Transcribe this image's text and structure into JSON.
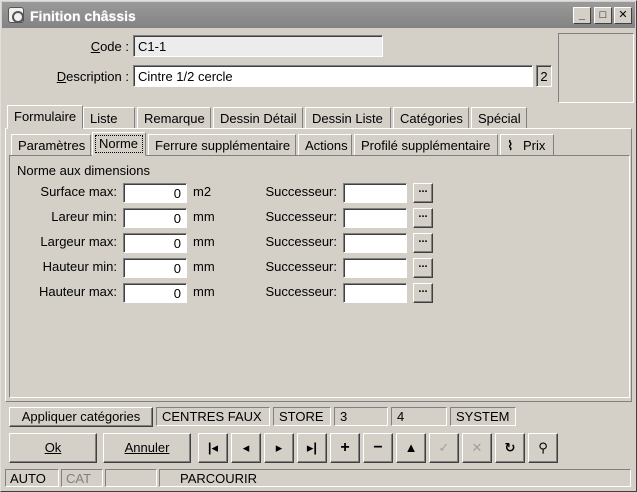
{
  "window": {
    "title": "Finition châssis"
  },
  "header": {
    "code_label": "Code :",
    "code_value": "C1-1",
    "description_label": "Description :",
    "description_value": "Cintre 1/2 cercle",
    "description_badge": "2"
  },
  "main_tabs": [
    "Formulaire",
    "Liste",
    "Remarque",
    "Dessin Détail",
    "Dessin Liste",
    "Catégories",
    "Spécial"
  ],
  "sub_tabs": [
    "Paramètres",
    "Norme",
    "Ferrure supplémentaire",
    "Actions",
    "Profilé supplémentaire",
    "Prix"
  ],
  "section_title": "Norme aux dimensions",
  "successor_label": "Successeur:",
  "rows": [
    {
      "label": "Surface max:",
      "value": "0",
      "unit": "m2",
      "successor": ""
    },
    {
      "label": "Lareur min:",
      "value": "0",
      "unit": "mm",
      "successor": ""
    },
    {
      "label": "Largeur max:",
      "value": "0",
      "unit": "mm",
      "successor": ""
    },
    {
      "label": "Hauteur min:",
      "value": "0",
      "unit": "mm",
      "successor": ""
    },
    {
      "label": "Hauteur max:",
      "value": "0",
      "unit": "mm",
      "successor": ""
    }
  ],
  "dots_label": "...",
  "record_bar": {
    "apply_categories": "Appliquer catégories",
    "cells": [
      "CENTRES FAUX",
      "STORE",
      "3",
      "4",
      "SYSTEM"
    ]
  },
  "buttons": {
    "ok": "Ok",
    "cancel": "Annuler"
  },
  "nav_icons": [
    "first-record-icon",
    "previous-record-icon",
    "next-record-icon",
    "last-record-icon",
    "add-record-icon",
    "delete-record-icon",
    "move-up-icon",
    "confirm-icon",
    "cancel-edit-icon",
    "refresh-icon",
    "search-binoculars-icon"
  ],
  "status_bar": [
    "AUTO",
    "CAT",
    "",
    "PARCOURIR"
  ],
  "colors": {
    "window_bg": "#d4d0c8",
    "titlebar": "#8c8c8c",
    "field_bg": "#ffffff"
  }
}
